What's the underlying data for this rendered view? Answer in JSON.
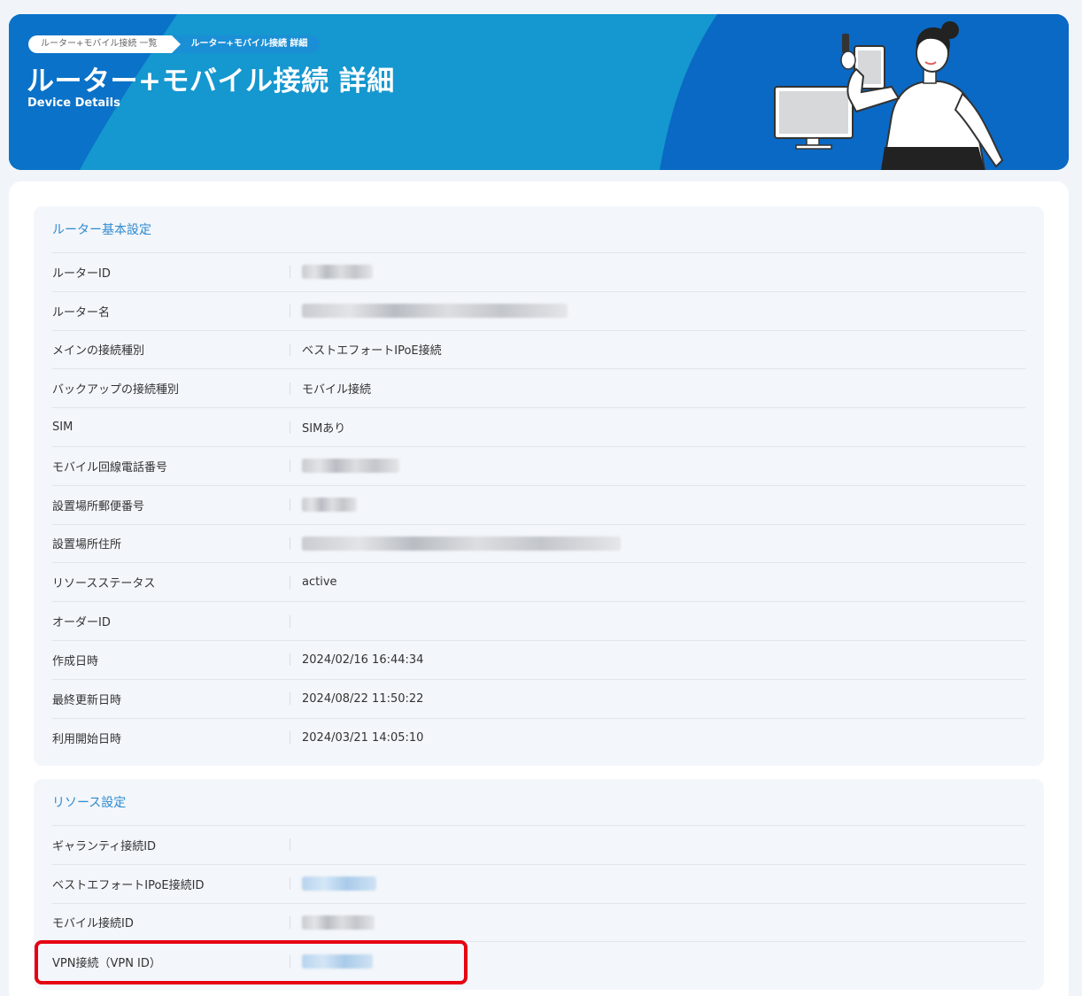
{
  "header": {
    "breadcrumbs": [
      "ルーター+モバイル接続 一覧",
      "ルーター+モバイル接続 詳細"
    ],
    "title": "ルーター+モバイル接続 詳細",
    "subtitle": "Device Details"
  },
  "sections": [
    {
      "title": "ルーター基本設定",
      "rows": [
        {
          "label": "ルーターID",
          "value": ""
        },
        {
          "label": "ルーター名",
          "value": ""
        },
        {
          "label": "メインの接続種別",
          "value": "ベストエフォートIPoE接続"
        },
        {
          "label": "バックアップの接続種別",
          "value": "モバイル接続"
        },
        {
          "label": "SIM",
          "value": "SIMあり"
        },
        {
          "label": "モバイル回線電話番号",
          "value": ""
        },
        {
          "label": "設置場所郵便番号",
          "value": ""
        },
        {
          "label": "設置場所住所",
          "value": ""
        },
        {
          "label": "リソースステータス",
          "value": "active"
        },
        {
          "label": "オーダーID",
          "value": ""
        },
        {
          "label": "作成日時",
          "value": "2024/02/16 16:44:34"
        },
        {
          "label": "最終更新日時",
          "value": "2024/08/22 11:50:22"
        },
        {
          "label": "利用開始日時",
          "value": "2024/03/21 14:05:10"
        }
      ]
    },
    {
      "title": "リソース設定",
      "rows": [
        {
          "label": "ギャランティ接続ID",
          "value": ""
        },
        {
          "label": "ベストエフォートIPoE接続ID",
          "value": ""
        },
        {
          "label": "モバイル接続ID",
          "value": ""
        },
        {
          "label": "VPN接続（VPN ID）",
          "value": ""
        }
      ]
    }
  ],
  "colors": {
    "banner_blue": "#0a69c4",
    "banner_light": "#1597cf",
    "section_title": "#2d8bd0",
    "highlight_red": "#e60012"
  }
}
